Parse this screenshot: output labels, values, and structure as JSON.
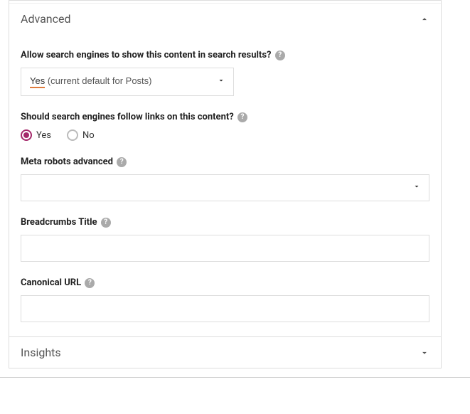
{
  "advanced": {
    "title": "Advanced",
    "allow_search": {
      "label": "Allow search engines to show this content in search results?",
      "value_prefix": "Yes",
      "value_suffix": " (current default for Posts)"
    },
    "follow_links": {
      "label": "Should search engines follow links on this content?",
      "yes": "Yes",
      "no": "No",
      "selected": "yes"
    },
    "meta_robots": {
      "label": "Meta robots advanced",
      "value": ""
    },
    "breadcrumbs": {
      "label": "Breadcrumbs Title",
      "value": ""
    },
    "canonical": {
      "label": "Canonical URL",
      "value": ""
    }
  },
  "insights": {
    "title": "Insights"
  }
}
